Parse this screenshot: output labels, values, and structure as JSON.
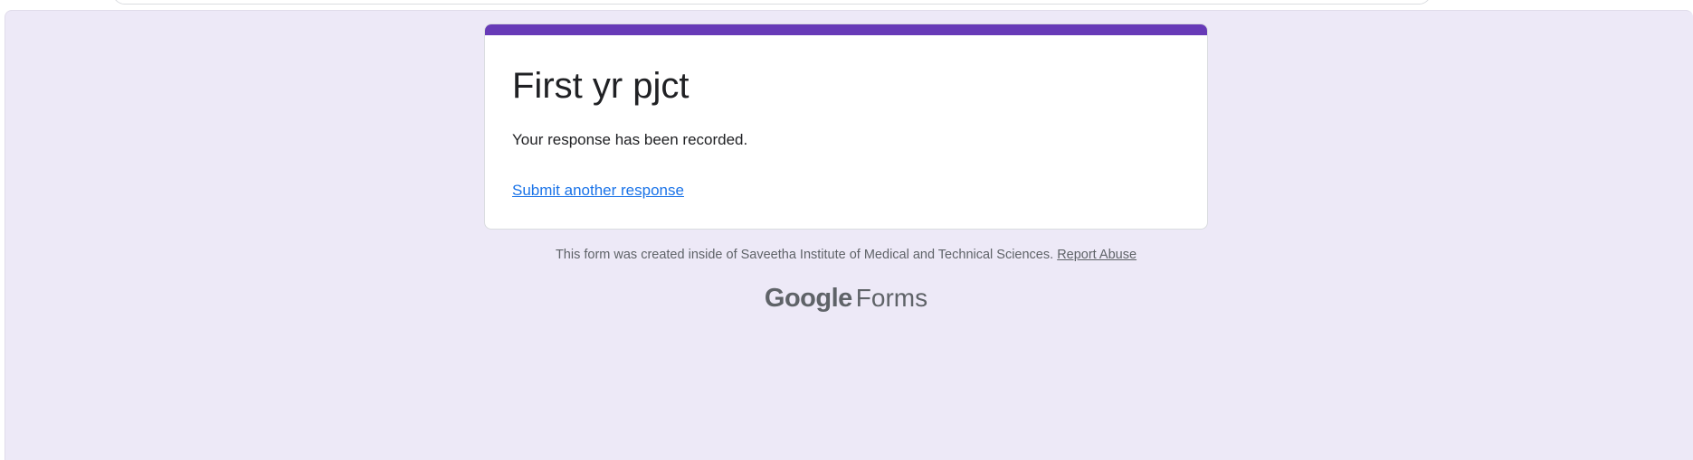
{
  "form": {
    "title": "First yr pjct",
    "confirmation_message": "Your response has been recorded.",
    "submit_another_label": "Submit another response"
  },
  "footer": {
    "created_inside_text": "This form was created inside of Saveetha Institute of Medical and Technical Sciences.",
    "report_abuse_label": "Report Abuse"
  },
  "branding": {
    "google_text": "Google",
    "forms_text": "Forms"
  },
  "colors": {
    "accent": "#673ab7",
    "page_background": "#ede9f7",
    "link": "#1a73e8",
    "muted_text": "#5f6368"
  }
}
